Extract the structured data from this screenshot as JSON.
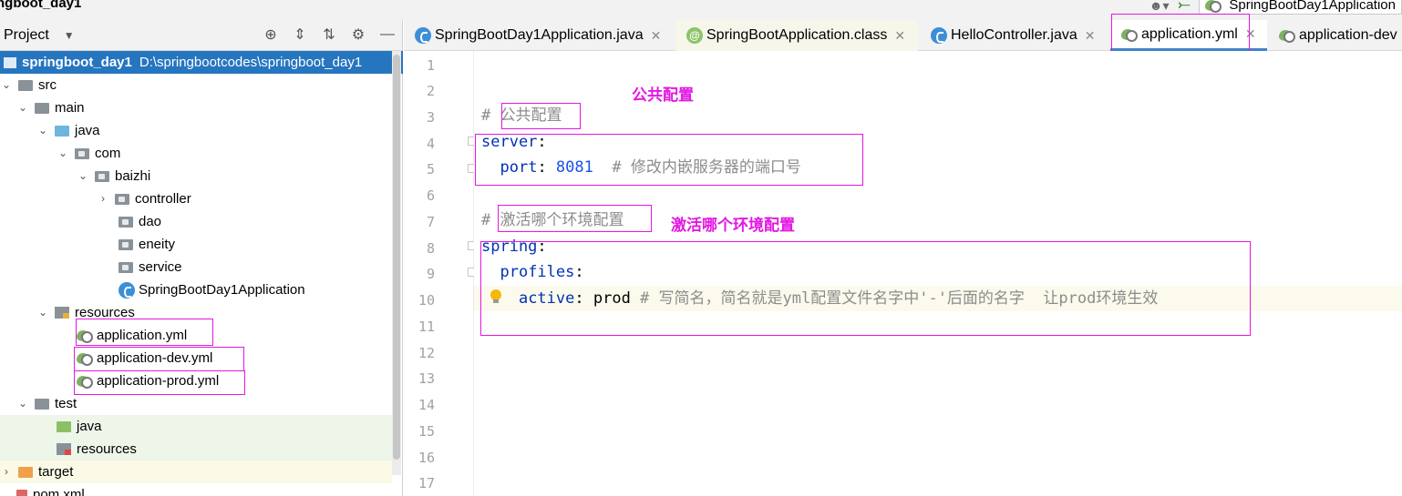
{
  "top": {
    "breadcrumb": "ngboot_day1",
    "run_config": "SpringBootDay1Application"
  },
  "project": {
    "title": "Project",
    "root_name": "springboot_day1",
    "root_path": "D:\\springbootcodes\\springboot_day1",
    "tree": {
      "src": "src",
      "main": "main",
      "java": "java",
      "com": "com",
      "baizhi": "baizhi",
      "controller": "controller",
      "dao": "dao",
      "eneity": "eneity",
      "service": "service",
      "app_class": "SpringBootDay1Application",
      "resources": "resources",
      "yml_main": "application.yml",
      "yml_dev": "application-dev.yml",
      "yml_prod": "application-prod.yml",
      "test": "test",
      "test_java": "java",
      "test_resources": "resources",
      "target": "target",
      "pom": "pom.xml"
    }
  },
  "tabs": [
    {
      "label": "SpringBootDay1Application.java",
      "icon": "class-icon"
    },
    {
      "label": "SpringBootApplication.class",
      "icon": "annotation-icon"
    },
    {
      "label": "HelloController.java",
      "icon": "class-icon"
    },
    {
      "label": "application.yml",
      "icon": "yml-icon",
      "active": true
    },
    {
      "label": "application-dev",
      "icon": "yml-icon"
    }
  ],
  "editor": {
    "line_numbers": [
      "1",
      "2",
      "3",
      "4",
      "5",
      "6",
      "7",
      "8",
      "9",
      "10",
      "11",
      "12",
      "13",
      "14",
      "15",
      "16",
      "17"
    ],
    "lines": {
      "l3_hash": "# ",
      "l3_comment": "公共配置",
      "l4_key": "server",
      "l4_colon": ":",
      "l5_indent": "  ",
      "l5_key": "port",
      "l5_colon": ": ",
      "l5_value": "8081",
      "l5_comment": "  # 修改内嵌服务器的端口号",
      "l7_hash": "# ",
      "l7_comment": "激活哪个环境配置",
      "l8_key": "spring",
      "l8_colon": ":",
      "l9_indent": "  ",
      "l9_key": "profiles",
      "l9_colon": ":",
      "l10_indent": "    ",
      "l10_key": "active",
      "l10_colon": ": ",
      "l10_value": "prod",
      "l10_comment": " # 写简名，简名就是yml配置文件名字中'-'后面的名字  让prod环境生效"
    }
  },
  "annotations": {
    "public_config": "公共配置",
    "activate_env": "激活哪个环境配置"
  },
  "colors": {
    "annotation": "#e317e3",
    "selection": "#2675bf",
    "keyword": "#0033b3",
    "number": "#1750eb",
    "comment": "#8c8c8c"
  }
}
